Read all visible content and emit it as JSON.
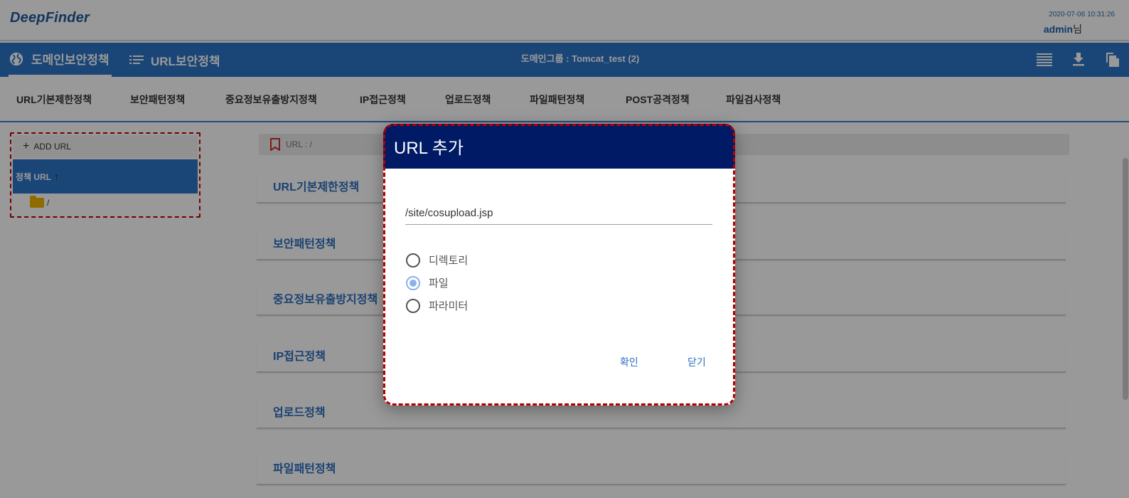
{
  "header": {
    "logo_text": "DeepFinder",
    "datetime": "2020-07-06 10:31:26",
    "user": "admin",
    "user_suffix": "님"
  },
  "nav": {
    "domain_policy": "도메인보안정책",
    "url_policy": "URL보안정책",
    "domain_group": "도메인그룹 : Tomcat_test (2)"
  },
  "subtabs": [
    "URL기본제한정책",
    "보안패턴정책",
    "중요정보유출방지정책",
    "IP접근정책",
    "업로드정책",
    "파일패턴정책",
    "POST공격정책",
    "파일검사정책"
  ],
  "tree": {
    "add_url": "ADD URL",
    "header": "정책 URL",
    "root_node": "/"
  },
  "breadcrumb": "URL : /",
  "sections": [
    "URL기본제한정책",
    "보안패턴정책",
    "중요정보유출방지정책",
    "IP접근정책",
    "업로드정책",
    "파일패턴정책"
  ],
  "dialog": {
    "title": "URL 추가",
    "url_value": "/site/cosupload.jsp",
    "options": [
      "디렉토리",
      "파일",
      "파라미터"
    ],
    "selected": "파일",
    "confirm": "확인",
    "close": "닫기"
  }
}
